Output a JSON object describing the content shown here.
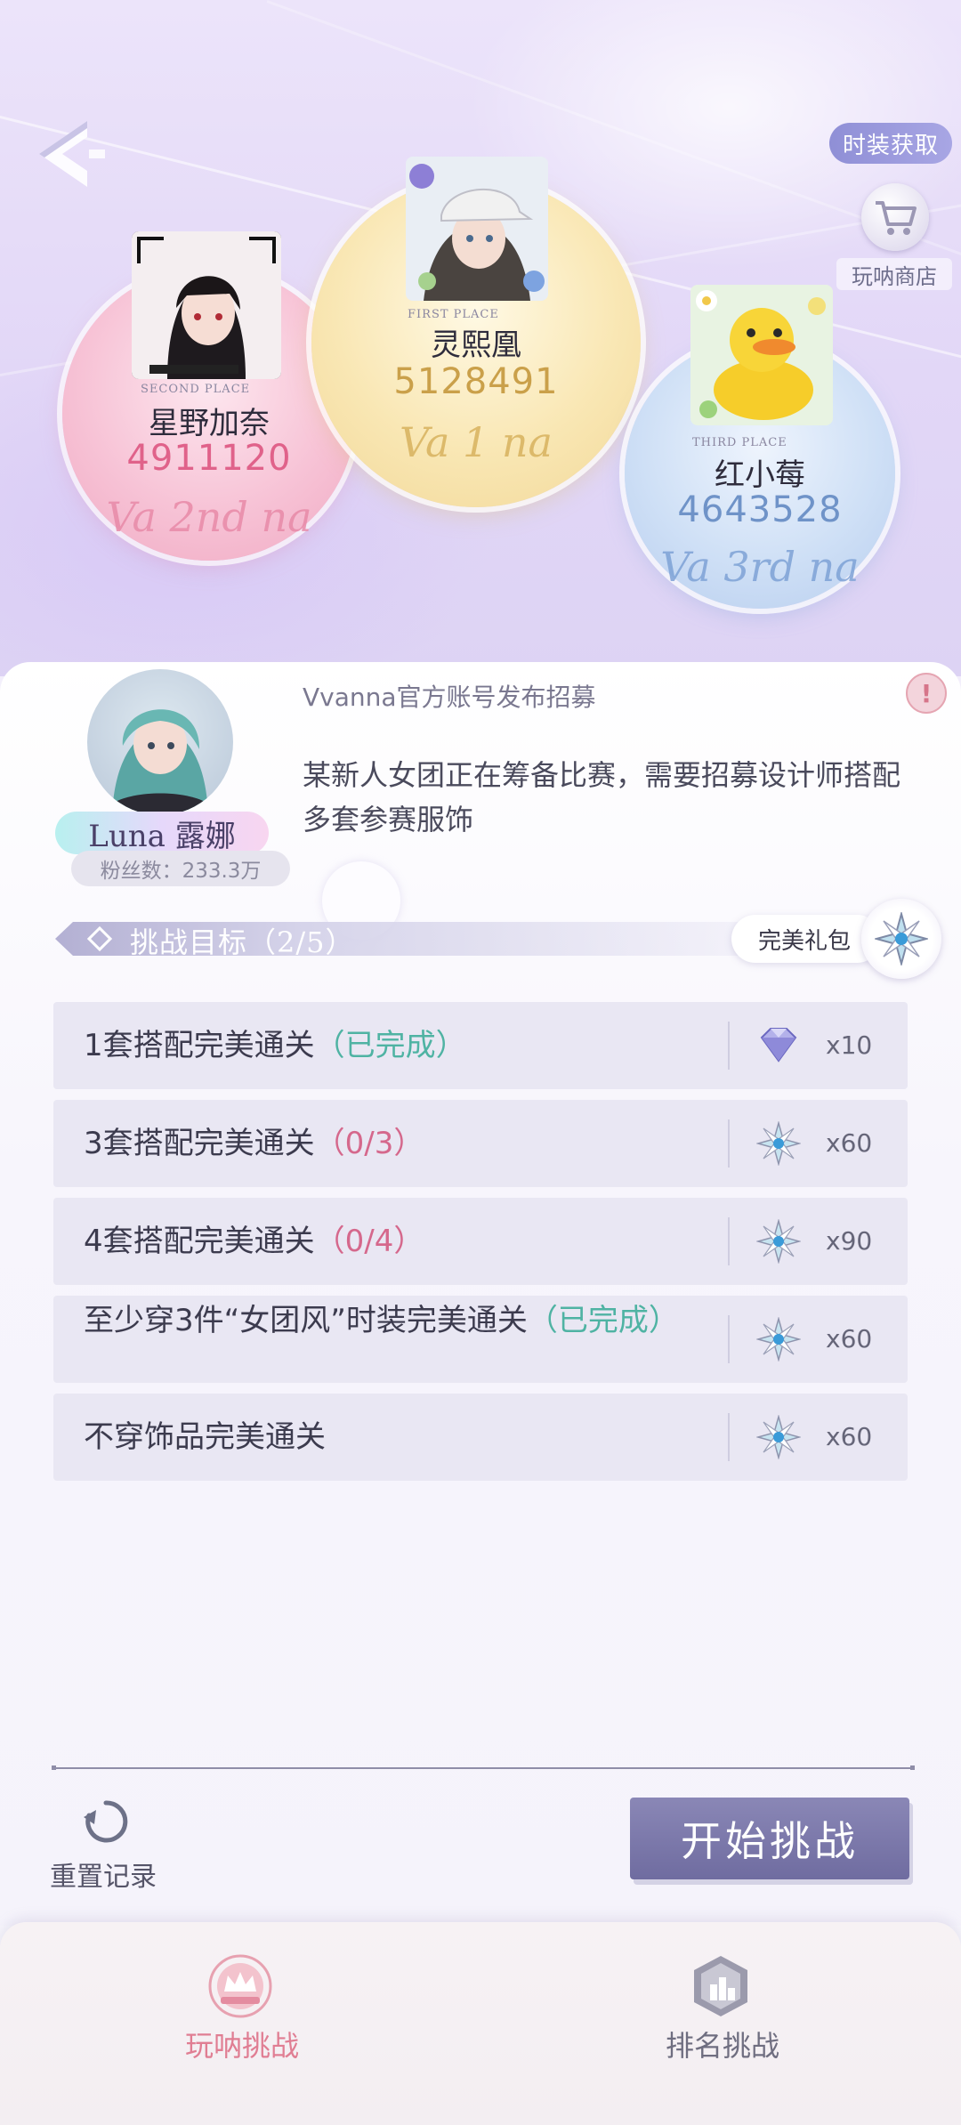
{
  "header": {
    "fashion_button": "时装获取",
    "shop_label": "玩呐商店"
  },
  "ranking": [
    {
      "place": "SECOND PLACE",
      "name": "星野加奈",
      "score": "4911120",
      "rank_mark": "Va 2nd na",
      "color": "#e0628a"
    },
    {
      "place": "FIRST PLACE",
      "name": "灵熙凰",
      "score": "5128491",
      "rank_mark": "Va 1 na",
      "color": "#caa04a"
    },
    {
      "place": "THIRD PLACE",
      "name": "红小莓",
      "score": "4643528",
      "rank_mark": "Va 3rd na",
      "color": "#6f93c8"
    }
  ],
  "task": {
    "title": "Vvanna官方账号发布招募",
    "description": "某新人女团正在筹备比赛，需要招募设计师搭配多套参赛服饰",
    "npc_name": "Luna 露娜",
    "npc_fans": "粉丝数：233.3万"
  },
  "challenge": {
    "title": "挑战目标（2/5）",
    "gift_label": "完美礼包",
    "goals": [
      {
        "text": "1套搭配完美通关",
        "status": "（已完成）",
        "status_type": "done",
        "reward_icon": "diamond-icon",
        "qty": "x10"
      },
      {
        "text": "3套搭配完美通关",
        "status": "（0/3）",
        "status_type": "pending",
        "reward_icon": "star-crystal-icon",
        "qty": "x60"
      },
      {
        "text": "4套搭配完美通关",
        "status": "（0/4）",
        "status_type": "pending",
        "reward_icon": "star-crystal-icon",
        "qty": "x90"
      },
      {
        "text": "至少穿3件“女团风”时装完美通关",
        "status": "（已完成）",
        "status_type": "done",
        "reward_icon": "star-crystal-icon",
        "qty": "x60"
      },
      {
        "text": "不穿饰品完美通关",
        "status": "",
        "status_type": "none",
        "reward_icon": "star-crystal-icon",
        "qty": "x60"
      }
    ]
  },
  "actions": {
    "reset_label": "重置记录",
    "start_label": "开始挑战"
  },
  "tabs": [
    {
      "label": "玩呐挑战",
      "active": true,
      "color": "#e07e93"
    },
    {
      "label": "排名挑战",
      "active": false,
      "color": "#6f6e80"
    }
  ]
}
